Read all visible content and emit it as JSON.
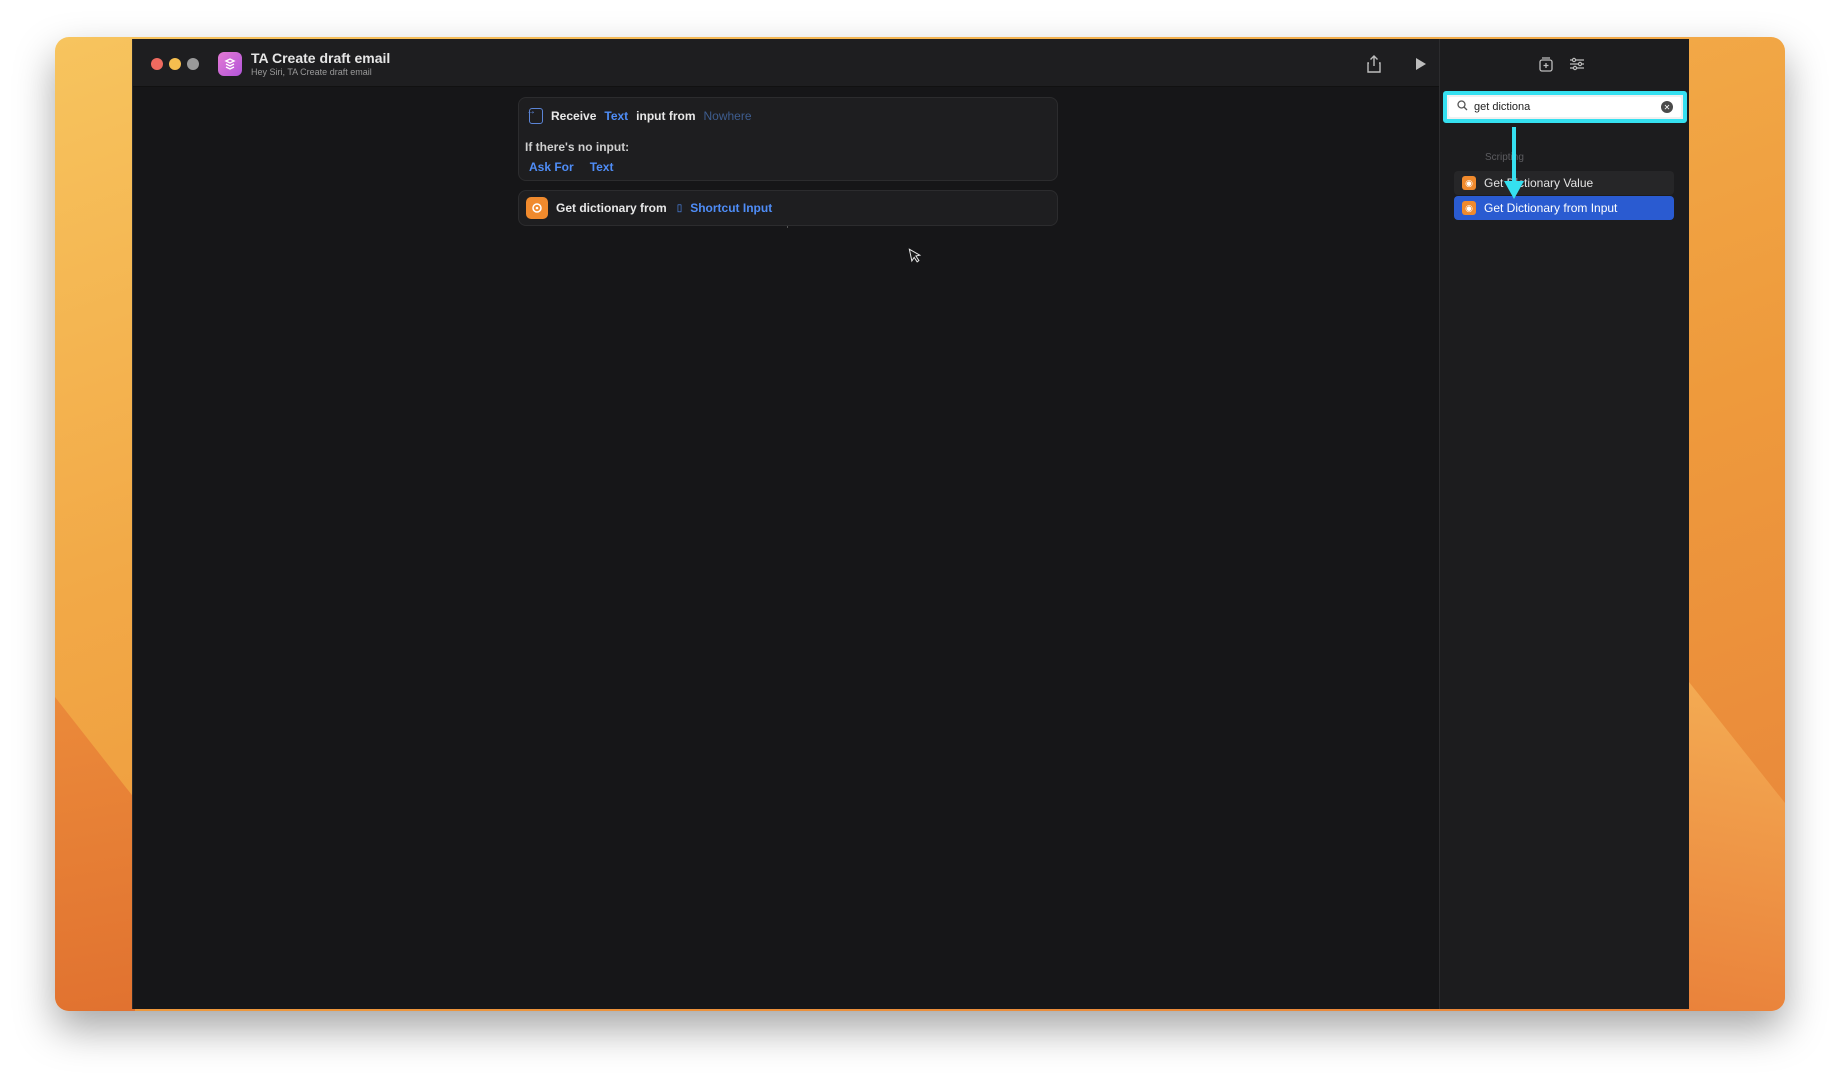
{
  "window": {
    "title": "TA Create draft email",
    "subtitle": "Hey Siri, TA Create draft email"
  },
  "icons": {
    "app": "shortcuts-app-icon",
    "share": "share-icon",
    "play": "play-icon",
    "library": "library-add-icon",
    "settings": "sliders-icon",
    "search": "search-icon",
    "clear": "clear-icon",
    "cursor": "mouse-cursor-icon"
  },
  "actions": {
    "receive": {
      "word_receive": "Receive",
      "token_type": "Text",
      "word_input_from": "input from",
      "token_source": "Nowhere",
      "no_input_label": "If there's no input:",
      "token_ask_for": "Ask For",
      "token_ask_type": "Text"
    },
    "get_dictionary": {
      "label": "Get dictionary from",
      "token_input": "Shortcut Input"
    }
  },
  "sidebar": {
    "search": {
      "value": "get dictiona",
      "placeholder": ""
    },
    "section": "Scripting",
    "results": [
      {
        "label": "Get Dictionary Value",
        "selected": false
      },
      {
        "label": "Get Dictionary from Input",
        "selected": true
      }
    ]
  },
  "colors": {
    "highlight_cyan": "#35e0f0",
    "selection_blue": "#2a5bd1",
    "token_blue": "#4f8df7",
    "action_orange": "#f08a2d"
  }
}
